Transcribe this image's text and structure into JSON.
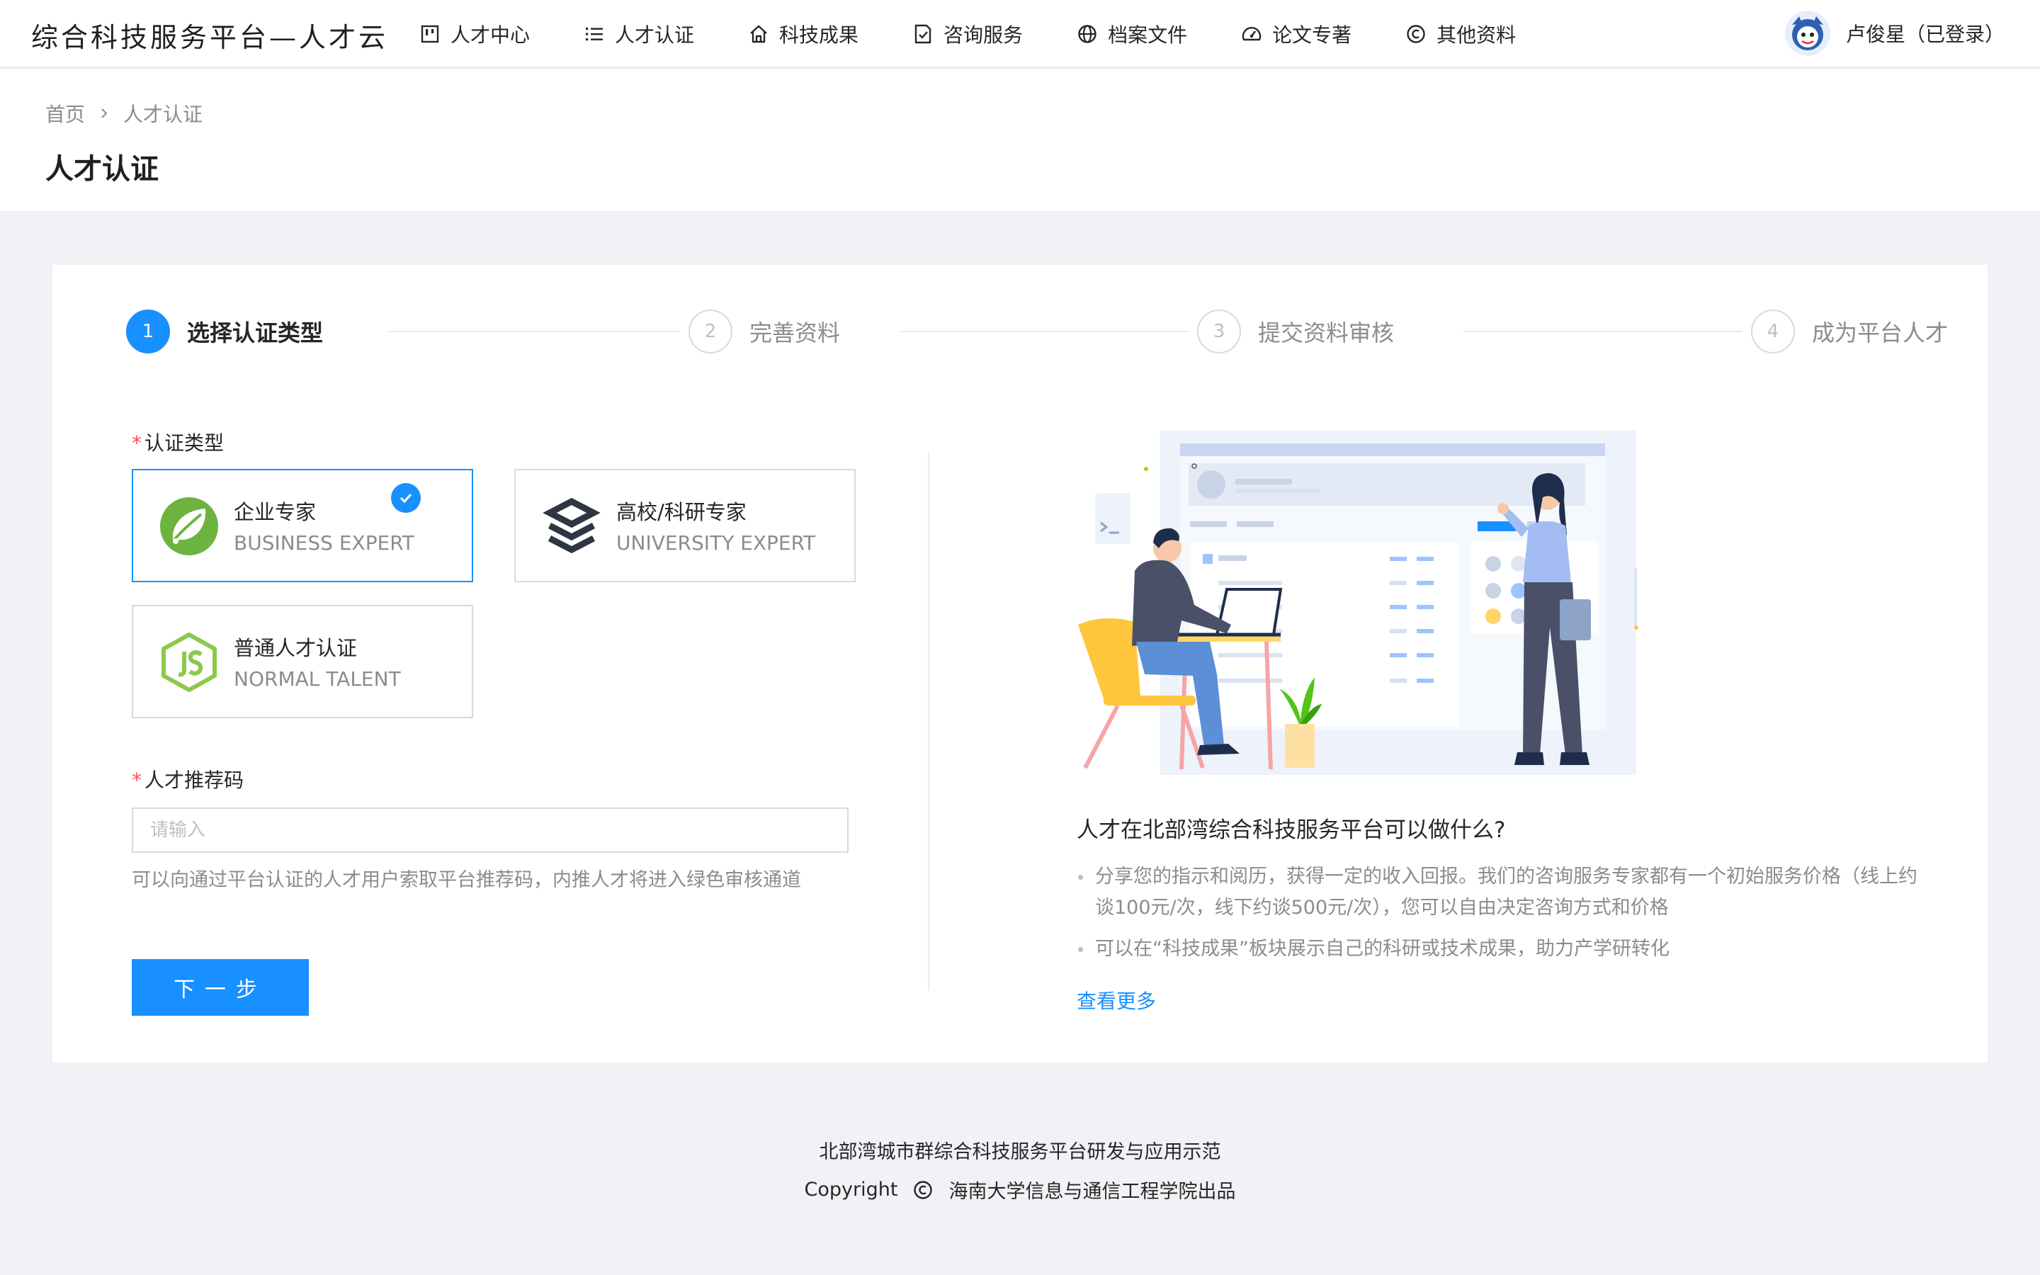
{
  "header": {
    "logo": "综合科技服务平台—人才云",
    "nav": [
      {
        "label": "人才中心",
        "icon": "board-icon"
      },
      {
        "label": "人才认证",
        "icon": "list-icon"
      },
      {
        "label": "科技成果",
        "icon": "home-icon"
      },
      {
        "label": "咨询服务",
        "icon": "checklist-icon"
      },
      {
        "label": "档案文件",
        "icon": "globe-icon"
      },
      {
        "label": "论文专著",
        "icon": "dashboard-icon"
      },
      {
        "label": "其他资料",
        "icon": "copyright-icon"
      }
    ],
    "user": {
      "name": "卢俊星（已登录）",
      "avatar_icon": "user-avatar"
    }
  },
  "breadcrumb": {
    "home": "首页",
    "current": "人才认证"
  },
  "page_title": "人才认证",
  "steps": [
    {
      "number": "1",
      "title": "选择认证类型",
      "state": "active"
    },
    {
      "number": "2",
      "title": "完善资料",
      "state": "wait"
    },
    {
      "number": "3",
      "title": "提交资料审核",
      "state": "wait"
    },
    {
      "number": "4",
      "title": "成为平台人才",
      "state": "wait"
    }
  ],
  "form": {
    "type_label": "认证类型",
    "types": [
      {
        "title": "企业专家",
        "subtitle": "BUSINESS EXPERT",
        "icon": "leaf-icon",
        "selected": true
      },
      {
        "title": "高校/科研专家",
        "subtitle": "UNIVERSITY EXPERT",
        "icon": "layers-icon",
        "selected": false
      },
      {
        "title": "普通人才认证",
        "subtitle": "NORMAL TALENT",
        "icon": "js-hexagon-icon",
        "selected": false
      }
    ],
    "code_label": "人才推荐码",
    "code_value": "",
    "code_placeholder": "请输入",
    "code_hint": "可以向通过平台认证的人才用户索取平台推荐码，内推人才将进入绿色审核通道",
    "next_button": "下一步"
  },
  "info": {
    "title": "人才在北部湾综合科技服务平台可以做什么?",
    "items": [
      "分享您的指示和阅历，获得一定的收入回报。我们的咨询服务专家都有一个初始服务价格（线上约谈100元/次，线下约谈500元/次），您可以自由决定咨询方式和价格",
      "可以在“科技成果”板块展示自己的科研或技术成果，助力产学研转化"
    ],
    "more_link": "查看更多"
  },
  "footer": {
    "line1": "北部湾城市群综合科技服务平台研发与应用示范",
    "copyright": "Copyright",
    "org": "海南大学信息与通信工程学院出品"
  },
  "colors": {
    "primary": "#1890ff",
    "required": "#ff4d4f",
    "leaf_green": "#6db33f",
    "js_green": "#8cc84b"
  }
}
